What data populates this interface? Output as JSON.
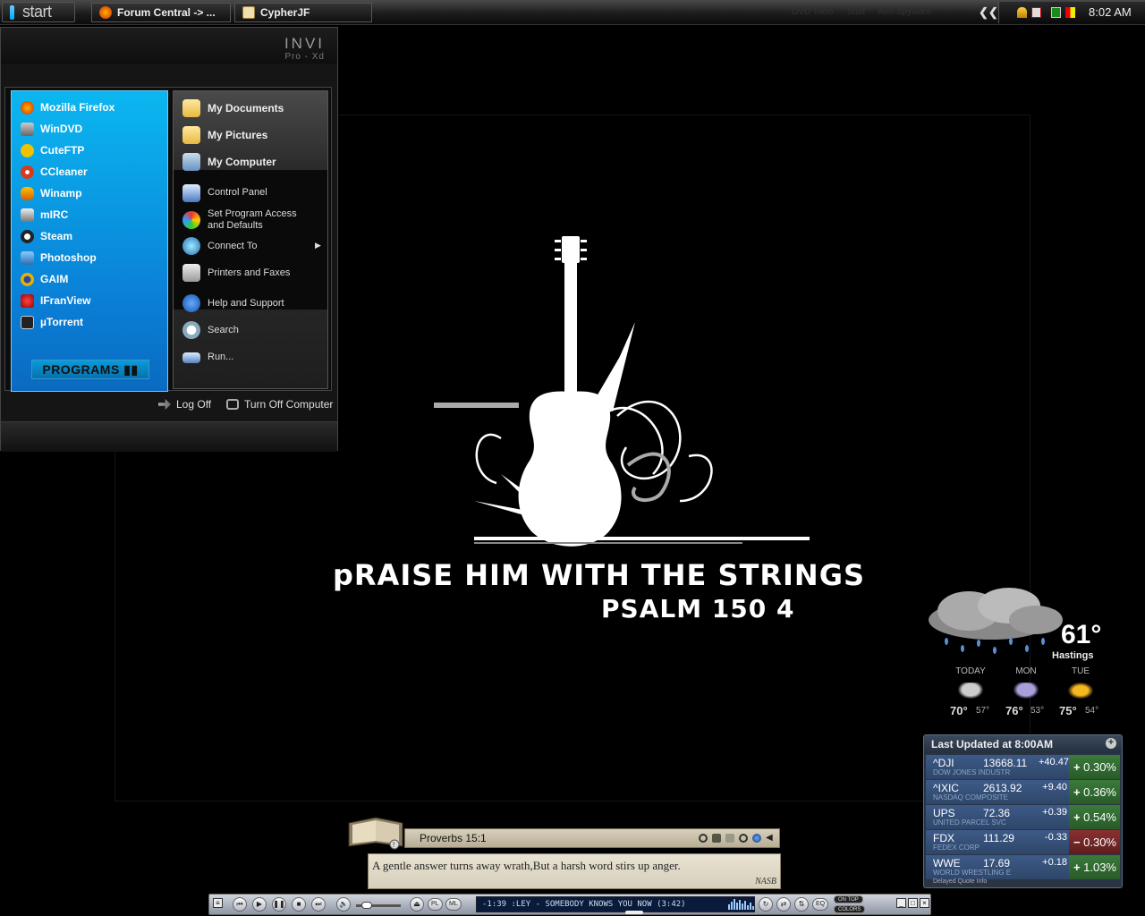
{
  "taskbar": {
    "start_label": "start",
    "tasks": [
      {
        "label": "Forum Central -> ...",
        "icon": "firefox-icon"
      },
      {
        "label": "CypherJF",
        "icon": "document-icon"
      }
    ],
    "quick_links": [
      "DVD Tools",
      "Stuff",
      "Anti-Spyware"
    ],
    "clock": "8:02 AM"
  },
  "start_menu": {
    "brand": "INVI",
    "brand_sub": "Pro - Xd",
    "pinned": [
      {
        "label": "Mozilla Firefox",
        "icon": "firefox-icon",
        "color": "#e66000"
      },
      {
        "label": "WinDVD",
        "icon": "windvd-icon",
        "color": "#888888"
      },
      {
        "label": "CuteFTP",
        "icon": "cuteftp-icon",
        "color": "#f2c200"
      },
      {
        "label": "CCleaner",
        "icon": "ccleaner-icon",
        "color": "#d83a1a"
      },
      {
        "label": "Winamp",
        "icon": "winamp-icon",
        "color": "#f08a00"
      },
      {
        "label": "mIRC",
        "icon": "mirc-icon",
        "color": "#444444"
      },
      {
        "label": "Steam",
        "icon": "steam-icon",
        "color": "#222222"
      },
      {
        "label": "Photoshop",
        "icon": "photoshop-icon",
        "color": "#2a6fb0"
      },
      {
        "label": "GAIM",
        "icon": "gaim-icon",
        "color": "#e8b000"
      },
      {
        "label": "IFranView",
        "icon": "irfanview-icon",
        "color": "#cc2222"
      },
      {
        "label": "µTorrent",
        "icon": "utorrent-icon",
        "color": "#2a2a2a"
      }
    ],
    "programs_label": "PROGRAMS",
    "places": [
      {
        "label": "My Documents",
        "icon": "documents-folder-icon"
      },
      {
        "label": "My Pictures",
        "icon": "pictures-folder-icon"
      },
      {
        "label": "My Computer",
        "icon": "computer-icon"
      }
    ],
    "system": [
      {
        "label": "Control Panel",
        "icon": "control-panel-icon"
      },
      {
        "label": "Set Program Access",
        "label2": "and Defaults",
        "icon": "program-access-icon"
      },
      {
        "label": "Connect To",
        "icon": "globe-icon"
      },
      {
        "label": "Printers and Faxes",
        "icon": "printer-icon"
      }
    ],
    "tools": [
      {
        "label": "Help and Support",
        "icon": "help-icon"
      },
      {
        "label": "Search",
        "icon": "search-icon"
      },
      {
        "label": "Run...",
        "icon": "run-icon"
      }
    ],
    "log_off": "Log Off",
    "turn_off": "Turn Off Computer"
  },
  "wallpaper": {
    "title": "pRAISE HIM WITH THE STRINGS",
    "verse": "PSALM 150 4"
  },
  "weather": {
    "temp": "61°",
    "city": "Hastings",
    "days": [
      {
        "label": "TODAY",
        "hi": "70°",
        "lo": "57°",
        "icon": "rain-icon"
      },
      {
        "label": "MON",
        "hi": "76°",
        "lo": "53°",
        "icon": "thunderstorm-icon"
      },
      {
        "label": "TUE",
        "hi": "75°",
        "lo": "54°",
        "icon": "partly-sunny-icon"
      }
    ]
  },
  "stocks": {
    "header": "Last Updated at 8:00AM",
    "rows": [
      {
        "symbol": "^DJI",
        "price": "13668.11",
        "name": "DOW JONES INDUSTR",
        "change": "+40.47",
        "pct": "0.30%",
        "dir": "up",
        "sign": "+"
      },
      {
        "symbol": "^IXIC",
        "price": "2613.92",
        "name": "NASDAQ COMPOSITE",
        "change": "+9.40",
        "pct": "0.36%",
        "dir": "up",
        "sign": "+"
      },
      {
        "symbol": "UPS",
        "price": "72.36",
        "name": "UNITED PARCEL SVC",
        "change": "+0.39",
        "pct": "0.54%",
        "dir": "up",
        "sign": "+"
      },
      {
        "symbol": "FDX",
        "price": "111.29",
        "name": "FEDEX CORP",
        "change": "-0.33",
        "pct": "0.30%",
        "dir": "down",
        "sign": "−"
      },
      {
        "symbol": "WWE",
        "price": "17.69",
        "name": "WORLD WRESTLING E",
        "change": "+0.18",
        "pct": "1.03%",
        "dir": "up",
        "sign": "+"
      }
    ],
    "footer": "Delayed Quote Info"
  },
  "bible_widget": {
    "reference": "Proverbs 15:1",
    "text": "A gentle answer turns away wrath,But a harsh word stirs up anger.",
    "version": "NASB"
  },
  "player": {
    "display": "-1:39  :LEY - SOMEBODY KNOWS YOU NOW (3:42)",
    "pl_label": "PL",
    "ml_label": "ML",
    "eq_label": "EQ",
    "on_top_label": "ON TOP",
    "colors_label": "COLORS"
  }
}
